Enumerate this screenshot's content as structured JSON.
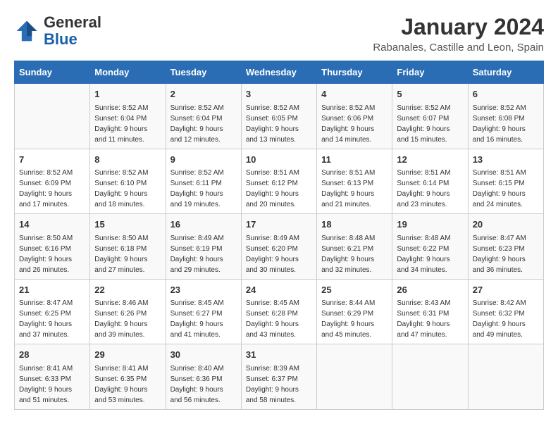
{
  "logo": {
    "general": "General",
    "blue": "Blue"
  },
  "header": {
    "month_year": "January 2024",
    "location": "Rabanales, Castille and Leon, Spain"
  },
  "days_of_week": [
    "Sunday",
    "Monday",
    "Tuesday",
    "Wednesday",
    "Thursday",
    "Friday",
    "Saturday"
  ],
  "weeks": [
    [
      {
        "day": "",
        "info": ""
      },
      {
        "day": "1",
        "info": "Sunrise: 8:52 AM\nSunset: 6:04 PM\nDaylight: 9 hours\nand 11 minutes."
      },
      {
        "day": "2",
        "info": "Sunrise: 8:52 AM\nSunset: 6:04 PM\nDaylight: 9 hours\nand 12 minutes."
      },
      {
        "day": "3",
        "info": "Sunrise: 8:52 AM\nSunset: 6:05 PM\nDaylight: 9 hours\nand 13 minutes."
      },
      {
        "day": "4",
        "info": "Sunrise: 8:52 AM\nSunset: 6:06 PM\nDaylight: 9 hours\nand 14 minutes."
      },
      {
        "day": "5",
        "info": "Sunrise: 8:52 AM\nSunset: 6:07 PM\nDaylight: 9 hours\nand 15 minutes."
      },
      {
        "day": "6",
        "info": "Sunrise: 8:52 AM\nSunset: 6:08 PM\nDaylight: 9 hours\nand 16 minutes."
      }
    ],
    [
      {
        "day": "7",
        "info": "Sunrise: 8:52 AM\nSunset: 6:09 PM\nDaylight: 9 hours\nand 17 minutes."
      },
      {
        "day": "8",
        "info": "Sunrise: 8:52 AM\nSunset: 6:10 PM\nDaylight: 9 hours\nand 18 minutes."
      },
      {
        "day": "9",
        "info": "Sunrise: 8:52 AM\nSunset: 6:11 PM\nDaylight: 9 hours\nand 19 minutes."
      },
      {
        "day": "10",
        "info": "Sunrise: 8:51 AM\nSunset: 6:12 PM\nDaylight: 9 hours\nand 20 minutes."
      },
      {
        "day": "11",
        "info": "Sunrise: 8:51 AM\nSunset: 6:13 PM\nDaylight: 9 hours\nand 21 minutes."
      },
      {
        "day": "12",
        "info": "Sunrise: 8:51 AM\nSunset: 6:14 PM\nDaylight: 9 hours\nand 23 minutes."
      },
      {
        "day": "13",
        "info": "Sunrise: 8:51 AM\nSunset: 6:15 PM\nDaylight: 9 hours\nand 24 minutes."
      }
    ],
    [
      {
        "day": "14",
        "info": "Sunrise: 8:50 AM\nSunset: 6:16 PM\nDaylight: 9 hours\nand 26 minutes."
      },
      {
        "day": "15",
        "info": "Sunrise: 8:50 AM\nSunset: 6:18 PM\nDaylight: 9 hours\nand 27 minutes."
      },
      {
        "day": "16",
        "info": "Sunrise: 8:49 AM\nSunset: 6:19 PM\nDaylight: 9 hours\nand 29 minutes."
      },
      {
        "day": "17",
        "info": "Sunrise: 8:49 AM\nSunset: 6:20 PM\nDaylight: 9 hours\nand 30 minutes."
      },
      {
        "day": "18",
        "info": "Sunrise: 8:48 AM\nSunset: 6:21 PM\nDaylight: 9 hours\nand 32 minutes."
      },
      {
        "day": "19",
        "info": "Sunrise: 8:48 AM\nSunset: 6:22 PM\nDaylight: 9 hours\nand 34 minutes."
      },
      {
        "day": "20",
        "info": "Sunrise: 8:47 AM\nSunset: 6:23 PM\nDaylight: 9 hours\nand 36 minutes."
      }
    ],
    [
      {
        "day": "21",
        "info": "Sunrise: 8:47 AM\nSunset: 6:25 PM\nDaylight: 9 hours\nand 37 minutes."
      },
      {
        "day": "22",
        "info": "Sunrise: 8:46 AM\nSunset: 6:26 PM\nDaylight: 9 hours\nand 39 minutes."
      },
      {
        "day": "23",
        "info": "Sunrise: 8:45 AM\nSunset: 6:27 PM\nDaylight: 9 hours\nand 41 minutes."
      },
      {
        "day": "24",
        "info": "Sunrise: 8:45 AM\nSunset: 6:28 PM\nDaylight: 9 hours\nand 43 minutes."
      },
      {
        "day": "25",
        "info": "Sunrise: 8:44 AM\nSunset: 6:29 PM\nDaylight: 9 hours\nand 45 minutes."
      },
      {
        "day": "26",
        "info": "Sunrise: 8:43 AM\nSunset: 6:31 PM\nDaylight: 9 hours\nand 47 minutes."
      },
      {
        "day": "27",
        "info": "Sunrise: 8:42 AM\nSunset: 6:32 PM\nDaylight: 9 hours\nand 49 minutes."
      }
    ],
    [
      {
        "day": "28",
        "info": "Sunrise: 8:41 AM\nSunset: 6:33 PM\nDaylight: 9 hours\nand 51 minutes."
      },
      {
        "day": "29",
        "info": "Sunrise: 8:41 AM\nSunset: 6:35 PM\nDaylight: 9 hours\nand 53 minutes."
      },
      {
        "day": "30",
        "info": "Sunrise: 8:40 AM\nSunset: 6:36 PM\nDaylight: 9 hours\nand 56 minutes."
      },
      {
        "day": "31",
        "info": "Sunrise: 8:39 AM\nSunset: 6:37 PM\nDaylight: 9 hours\nand 58 minutes."
      },
      {
        "day": "",
        "info": ""
      },
      {
        "day": "",
        "info": ""
      },
      {
        "day": "",
        "info": ""
      }
    ]
  ]
}
